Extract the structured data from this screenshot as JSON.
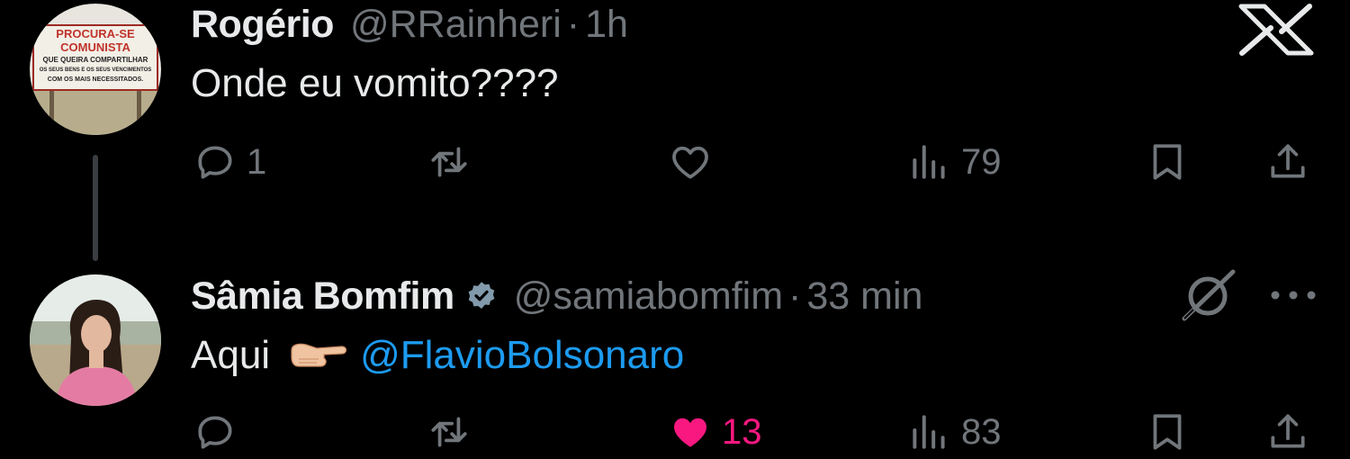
{
  "tweets": [
    {
      "name": "Rogério",
      "handle": "@RRainheri",
      "separator": "·",
      "time": "1h",
      "text": "Onde eu vomito????",
      "mention": "",
      "verified": false,
      "avatar": {
        "sign_line1": "PROCURA-SE",
        "sign_line2": "COMUNISTA",
        "sign_line3": "QUE QUEIRA COMPARTILHAR",
        "sign_line4": "OS SEUS BENS E OS SEUS VENCIMENTOS",
        "sign_line5": "COM OS MAIS NECESSITADOS."
      },
      "stats": {
        "replies": "1",
        "retweets": "",
        "likes": "",
        "views": "79"
      },
      "liked": false
    },
    {
      "name": "Sâmia Bomfim",
      "handle": "@samiabomfim",
      "separator": "·",
      "time": "33 min",
      "text": "Aqui",
      "mention": "@FlavioBolsonaro",
      "verified": true,
      "stats": {
        "replies": "",
        "retweets": "",
        "likes": "13",
        "views": "83"
      },
      "liked": true
    }
  ],
  "icons": {
    "top_right": "x-logo-icon",
    "grok": "grok-icon",
    "more": "more-icon",
    "reply": "reply-icon",
    "retweet": "retweet-icon",
    "like": "heart-icon",
    "views": "views-icon",
    "bookmark": "bookmark-icon",
    "share": "share-icon"
  },
  "colors": {
    "background": "#000000",
    "text": "#e7e9ea",
    "secondary": "#71767b",
    "link": "#1d9bf0",
    "like_active": "#f91880",
    "verified_badge": "#829aab"
  }
}
